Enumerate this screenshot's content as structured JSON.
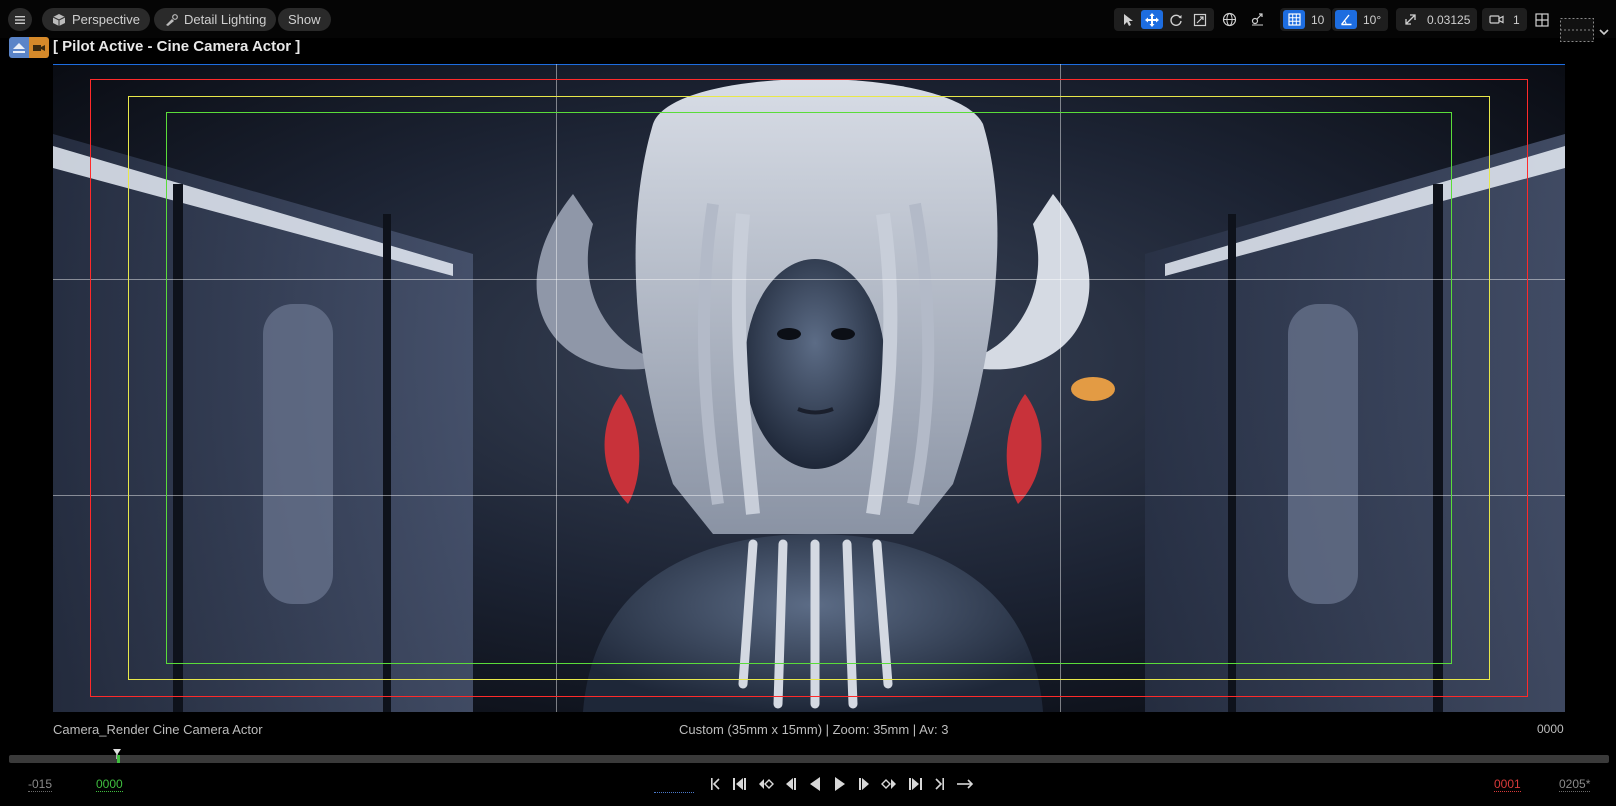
{
  "toolbar": {
    "perspective_label": "Perspective",
    "lighting_label": "Detail Lighting",
    "show_label": "Show",
    "grid_snap_value": "10",
    "rotation_snap_value": "10°",
    "scale_snap_value": "0.03125",
    "camera_speed_value": "1"
  },
  "pilot": {
    "label": "[ Pilot Active - Cine Camera Actor ]"
  },
  "info": {
    "camera_name": "Camera_Render  Cine Camera Actor",
    "lens_info": "Custom (35mm x 15mm) | Zoom: 35mm | Av: 3",
    "frame_right": "0000"
  },
  "timeline": {
    "start_offset": "-015",
    "current_frame": "0000",
    "end_red": "0001",
    "end_total": "0205*"
  },
  "colors": {
    "accent": "#1d6de0",
    "safe_red": "#ff2a2a",
    "safe_yellow": "#e8e84a",
    "safe_green": "#5adc3a"
  }
}
